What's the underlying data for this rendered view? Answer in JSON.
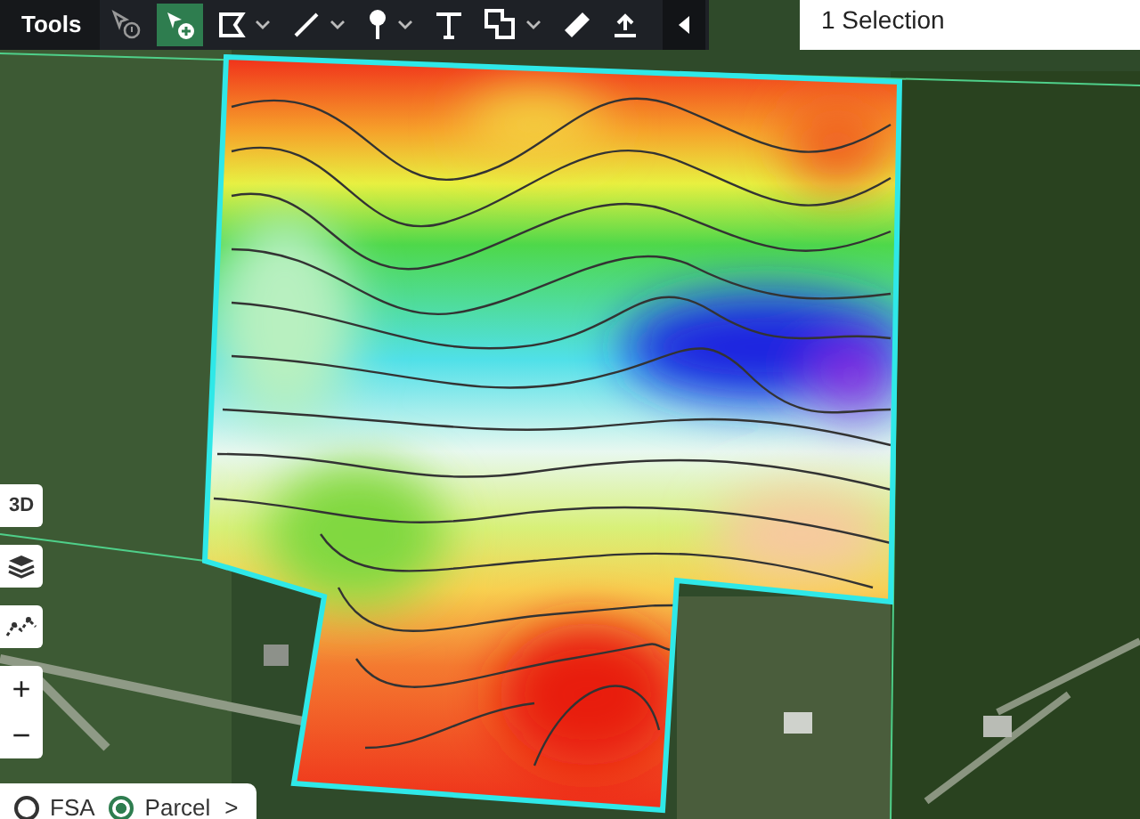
{
  "toolbar": {
    "title": "Tools",
    "tools": [
      {
        "kind": "pointer-info",
        "selected": false,
        "dropdown": false
      },
      {
        "kind": "select-add",
        "selected": true,
        "dropdown": false
      },
      {
        "kind": "polygon",
        "selected": false,
        "dropdown": true
      },
      {
        "kind": "line",
        "selected": false,
        "dropdown": true
      },
      {
        "kind": "pin",
        "selected": false,
        "dropdown": true
      },
      {
        "kind": "text",
        "selected": false,
        "dropdown": false
      },
      {
        "kind": "shapes",
        "selected": false,
        "dropdown": true
      },
      {
        "kind": "ruler",
        "selected": false,
        "dropdown": false
      },
      {
        "kind": "upload",
        "selected": false,
        "dropdown": false
      },
      {
        "kind": "collapse",
        "selected": false,
        "dropdown": false
      }
    ]
  },
  "selection_panel": {
    "title": "1 Selection"
  },
  "map_controls": {
    "view_toggle": "3D",
    "zoom_in": "+",
    "zoom_out": "−"
  },
  "boundary_layers": {
    "options": [
      {
        "label": "FSA",
        "selected": false
      },
      {
        "label": "Parcel",
        "selected": true
      }
    ],
    "more": ">"
  }
}
